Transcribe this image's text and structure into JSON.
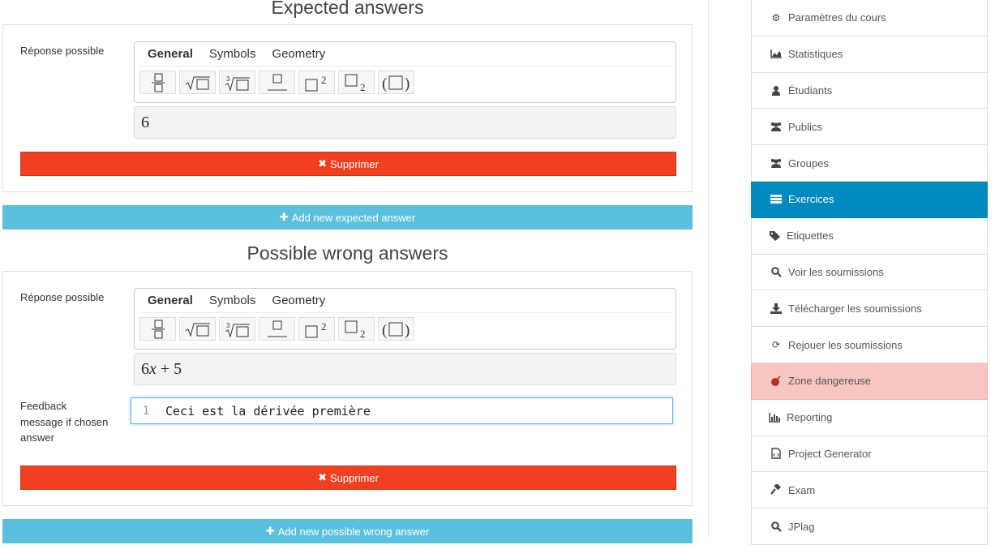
{
  "expected": {
    "title": "Expected answers",
    "label": "Réponse possible",
    "tabs": [
      "General",
      "Symbols",
      "Geometry"
    ],
    "value": "6",
    "delete_label": "Supprimer",
    "add_label": "Add new expected answer"
  },
  "wrong": {
    "title": "Possible wrong answers",
    "label": "Réponse possible",
    "tabs": [
      "General",
      "Symbols",
      "Geometry"
    ],
    "value_coeff": "6",
    "value_var": "x",
    "value_rest": " + 5",
    "feedback_label": "Feedback message if chosen answer",
    "feedback_line": "1",
    "feedback_text": "Ceci est la dérivée première",
    "delete_label": "Supprimer",
    "add_label": "Add new possible wrong answer"
  },
  "sidebar": {
    "items": [
      {
        "label": "Paramètres du cours",
        "icon": "gear-icon"
      },
      {
        "label": "Statistiques",
        "icon": "area-chart-icon"
      },
      {
        "label": "Étudiants",
        "icon": "user-icon"
      },
      {
        "label": "Publics",
        "icon": "users-icon"
      },
      {
        "label": "Groupes",
        "icon": "users-icon"
      },
      {
        "label": "Exercices",
        "icon": "tasks-icon"
      },
      {
        "label": "Etiquettes",
        "icon": "tags-icon"
      },
      {
        "label": "Voir les soumissions",
        "icon": "search-icon"
      },
      {
        "label": "Télécharger les soumissions",
        "icon": "download-icon"
      },
      {
        "label": "Rejouer les soumissions",
        "icon": "refresh-icon"
      },
      {
        "label": "Zone dangereuse",
        "icon": "bomb-icon"
      },
      {
        "label": "Reporting",
        "icon": "bar-chart-icon"
      },
      {
        "label": "Project Generator",
        "icon": "file-code-icon"
      },
      {
        "label": "Exam",
        "icon": "gavel-icon"
      },
      {
        "label": "JPlag",
        "icon": "search-icon"
      }
    ],
    "active": "Exercices",
    "danger": "Zone dangereuse"
  },
  "colors": {
    "delete": "#f0401f",
    "add": "#5bc0de",
    "active": "#0089bf",
    "danger": "#f7c6c0"
  }
}
